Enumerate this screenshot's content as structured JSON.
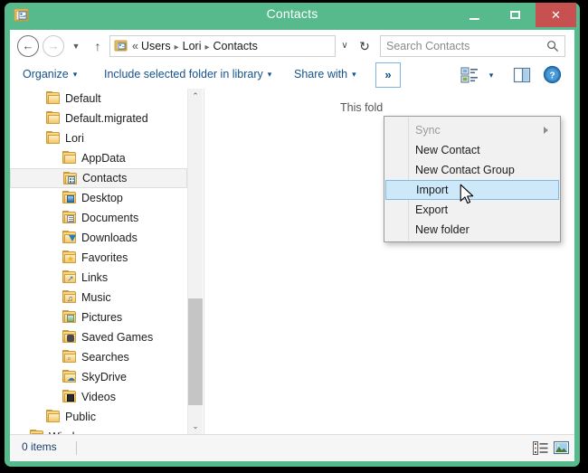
{
  "window": {
    "title": "Contacts",
    "accent_color": "#56ba8d",
    "close_color": "#c75050",
    "controls": {
      "minimize": "minimize-button",
      "maximize": "maximize-button",
      "close": "✕"
    }
  },
  "address_bar": {
    "back": "←",
    "forward": "→",
    "history": "▼",
    "up": "↑",
    "chevrons": "«",
    "path_segments": [
      "Users",
      "Lori",
      "Contacts"
    ],
    "separator": "▸",
    "dropdown": "∨",
    "refresh": "↻"
  },
  "search": {
    "placeholder": "Search Contacts",
    "value": "Search Contacts"
  },
  "command_bar": {
    "organize": "Organize",
    "include": "Include selected folder in library",
    "share": "Share with",
    "overflow": "»",
    "caret": "▾",
    "view_caret": "▾"
  },
  "nav_tree": {
    "items": [
      {
        "label": "Default",
        "indent": 0,
        "icon": "folder",
        "selected": false
      },
      {
        "label": "Default.migrated",
        "indent": 0,
        "icon": "folder",
        "selected": false
      },
      {
        "label": "Lori",
        "indent": 0,
        "icon": "folder",
        "selected": false
      },
      {
        "label": "AppData",
        "indent": 1,
        "icon": "folder",
        "selected": false
      },
      {
        "label": "Contacts",
        "indent": 1,
        "icon": "contacts",
        "selected": true
      },
      {
        "label": "Desktop",
        "indent": 1,
        "icon": "desktop",
        "selected": false
      },
      {
        "label": "Documents",
        "indent": 1,
        "icon": "documents",
        "selected": false
      },
      {
        "label": "Downloads",
        "indent": 1,
        "icon": "downloads",
        "selected": false
      },
      {
        "label": "Favorites",
        "indent": 1,
        "icon": "favorites",
        "selected": false
      },
      {
        "label": "Links",
        "indent": 1,
        "icon": "links",
        "selected": false
      },
      {
        "label": "Music",
        "indent": 1,
        "icon": "music",
        "selected": false
      },
      {
        "label": "Pictures",
        "indent": 1,
        "icon": "pictures",
        "selected": false
      },
      {
        "label": "Saved Games",
        "indent": 1,
        "icon": "games",
        "selected": false
      },
      {
        "label": "Searches",
        "indent": 1,
        "icon": "searches",
        "selected": false
      },
      {
        "label": "SkyDrive",
        "indent": 1,
        "icon": "skydrive",
        "selected": false
      },
      {
        "label": "Videos",
        "indent": 1,
        "icon": "videos",
        "selected": false
      },
      {
        "label": "Public",
        "indent": 0,
        "icon": "folder",
        "selected": false
      },
      {
        "label": "Windows",
        "indent": -1,
        "icon": "folder",
        "selected": false
      }
    ],
    "scroll_up": "⌃",
    "scroll_down": "⌄"
  },
  "content": {
    "empty_message": "This fold"
  },
  "overflow_menu": {
    "items": [
      {
        "label": "Sync",
        "disabled": true,
        "highlight": false,
        "submenu": true
      },
      {
        "label": "New Contact",
        "disabled": false,
        "highlight": false,
        "submenu": false
      },
      {
        "label": "New Contact Group",
        "disabled": false,
        "highlight": false,
        "submenu": false
      },
      {
        "label": "Import",
        "disabled": false,
        "highlight": true,
        "submenu": false
      },
      {
        "label": "Export",
        "disabled": false,
        "highlight": false,
        "submenu": false
      },
      {
        "label": "New folder",
        "disabled": false,
        "highlight": false,
        "submenu": false
      }
    ],
    "highlight_color": "#cce8f9",
    "highlight_border": "#7fb9e0"
  },
  "status_bar": {
    "item_count": "0 items"
  }
}
